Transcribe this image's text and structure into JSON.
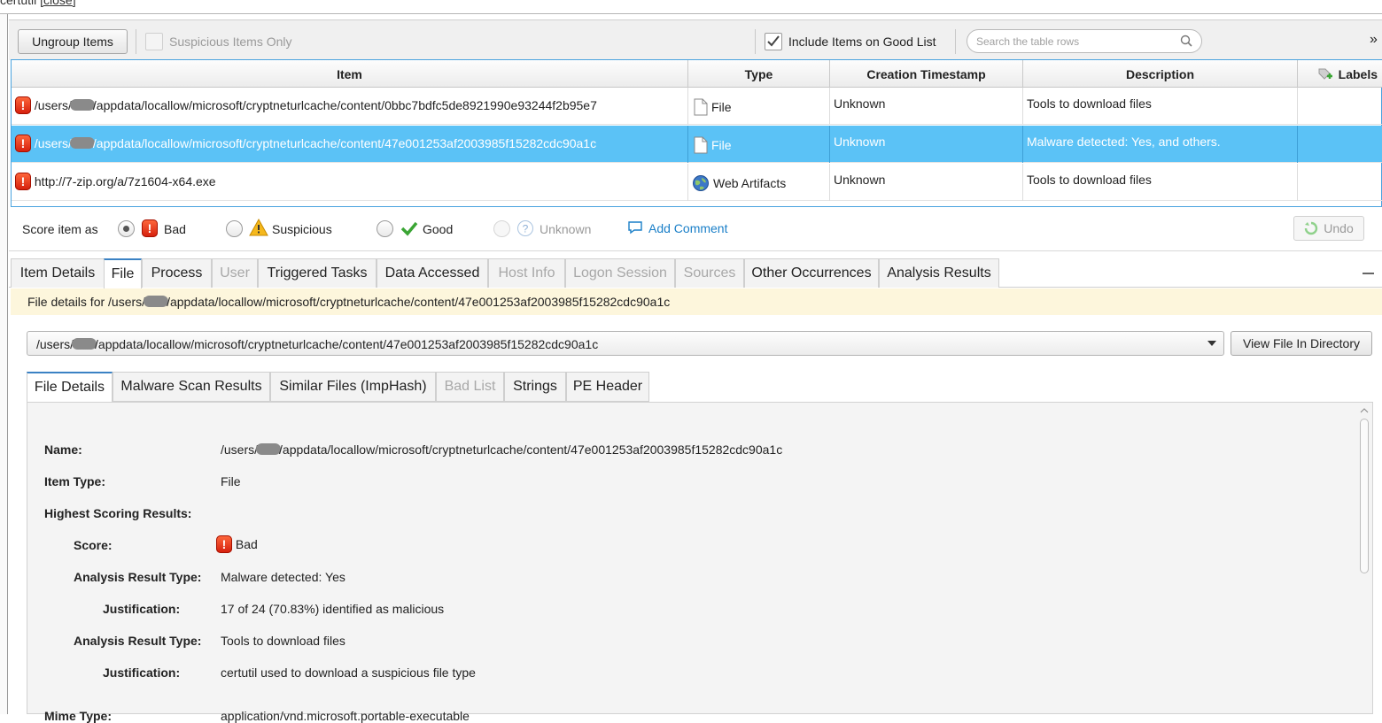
{
  "top_strip": {
    "text": "certutil",
    "link": "[close]"
  },
  "toolbar": {
    "ungroup_label": "Ungroup Items",
    "suspicious_only_label": "Suspicious Items Only",
    "include_good_label": "Include Items on Good List",
    "search_placeholder": "Search the table rows",
    "overflow": "»"
  },
  "table": {
    "headers": {
      "item": "Item",
      "type": "Type",
      "created": "Creation Timestamp",
      "description": "Description",
      "labels": "Labels"
    },
    "rows": [
      {
        "item_prefix": "/users/",
        "item_suffix": "/appdata/locallow/microsoft/cryptneturlcache/content/0bbc7bdfc5de8921990e93244f2b95e7",
        "type": "File",
        "created": "Unknown",
        "description": "Tools to download files"
      },
      {
        "item_prefix": "/users/",
        "item_suffix": "/appdata/locallow/microsoft/cryptneturlcache/content/47e001253af2003985f15282cdc90a1c",
        "type": "File",
        "created": "Unknown",
        "description": "Malware detected: Yes, and others."
      },
      {
        "item_prefix": "http://7-zip.org/a/7z1604-x64.exe",
        "item_suffix": "",
        "type": "Web Artifacts",
        "created": "Unknown",
        "description": "Tools to download files"
      }
    ]
  },
  "score": {
    "label": "Score item as",
    "bad": "Bad",
    "suspicious": "Suspicious",
    "good": "Good",
    "unknown": "Unknown",
    "add_comment": "Add Comment",
    "undo": "Undo"
  },
  "tabs": [
    "Item Details",
    "File",
    "Process",
    "User",
    "Triggered Tasks",
    "Data Accessed",
    "Host Info",
    "Logon Session",
    "Sources",
    "Other Occurrences",
    "Analysis Results"
  ],
  "banner": {
    "prefix": "File details for /users/",
    "suffix": "/appdata/locallow/microsoft/cryptneturlcache/content/47e001253af2003985f15282cdc90a1c"
  },
  "path_select": {
    "prefix": "/users/",
    "suffix": "/appdata/locallow/microsoft/cryptneturlcache/content/47e001253af2003985f15282cdc90a1c"
  },
  "view_in_directory": "View File In Directory",
  "subtabs": [
    "File Details",
    "Malware Scan Results",
    "Similar Files (ImpHash)",
    "Bad List",
    "Strings",
    "PE Header"
  ],
  "details": {
    "name_label": "Name:",
    "name_prefix": "/users/",
    "name_suffix": "/appdata/locallow/microsoft/cryptneturlcache/content/47e001253af2003985f15282cdc90a1c",
    "item_type_label": "Item Type:",
    "item_type": "File",
    "highest_label": "Highest Scoring Results:",
    "score_label": "Score:",
    "score_value": "Bad",
    "art1_label": "Analysis Result Type:",
    "art1_value": "Malware detected: Yes",
    "just1_label": "Justification:",
    "just1_value": "17 of 24 (70.83%) identified as malicious",
    "art2_label": "Analysis Result Type:",
    "art2_value": "Tools to download files",
    "just2_label": "Justification:",
    "just2_value": "certutil used to download a suspicious file type",
    "mime_label": "Mime Type:",
    "mime_value": "application/vnd.microsoft.portable-executable"
  },
  "colors": {
    "selected_row": "#5bc2f6",
    "accent": "#3b82c4",
    "bad": "#e0321a",
    "banner": "#fdf6dc",
    "link": "#1a7fc8"
  }
}
